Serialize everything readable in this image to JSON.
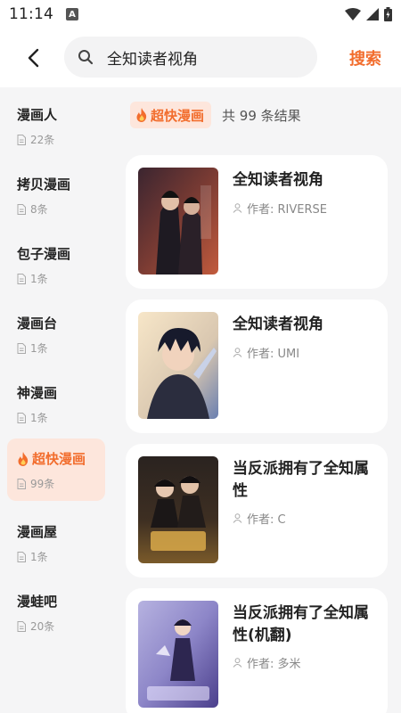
{
  "status_bar": {
    "time": "11:14",
    "notif_badge": "A"
  },
  "header": {
    "search_value": "全知读者视角",
    "search_button": "搜索"
  },
  "sidebar": {
    "items": [
      {
        "name": "漫画人",
        "count": "22条",
        "active": false
      },
      {
        "name": "拷贝漫画",
        "count": "8条",
        "active": false
      },
      {
        "name": "包子漫画",
        "count": "1条",
        "active": false
      },
      {
        "name": "漫画台",
        "count": "1条",
        "active": false
      },
      {
        "name": "神漫画",
        "count": "1条",
        "active": false
      },
      {
        "name": "超快漫画",
        "count": "99条",
        "active": true
      },
      {
        "name": "漫画屋",
        "count": "1条",
        "active": false
      },
      {
        "name": "漫蛙吧",
        "count": "20条",
        "active": false
      }
    ]
  },
  "main": {
    "source_badge": "超快漫画",
    "result_count": "共 99 条结果",
    "results": [
      {
        "title": "全知读者视角",
        "author": "作者: RIVERSE"
      },
      {
        "title": "全知读者视角",
        "author": "作者: UMI"
      },
      {
        "title": "当反派拥有了全知属性",
        "author": "作者: C"
      },
      {
        "title": "当反派拥有了全知属性(机翻)",
        "author": "作者: 多米"
      }
    ]
  },
  "colors": {
    "accent": "#f26d2d",
    "accent_bg": "#fde6dc",
    "panel_bg": "#f5f5f6"
  }
}
